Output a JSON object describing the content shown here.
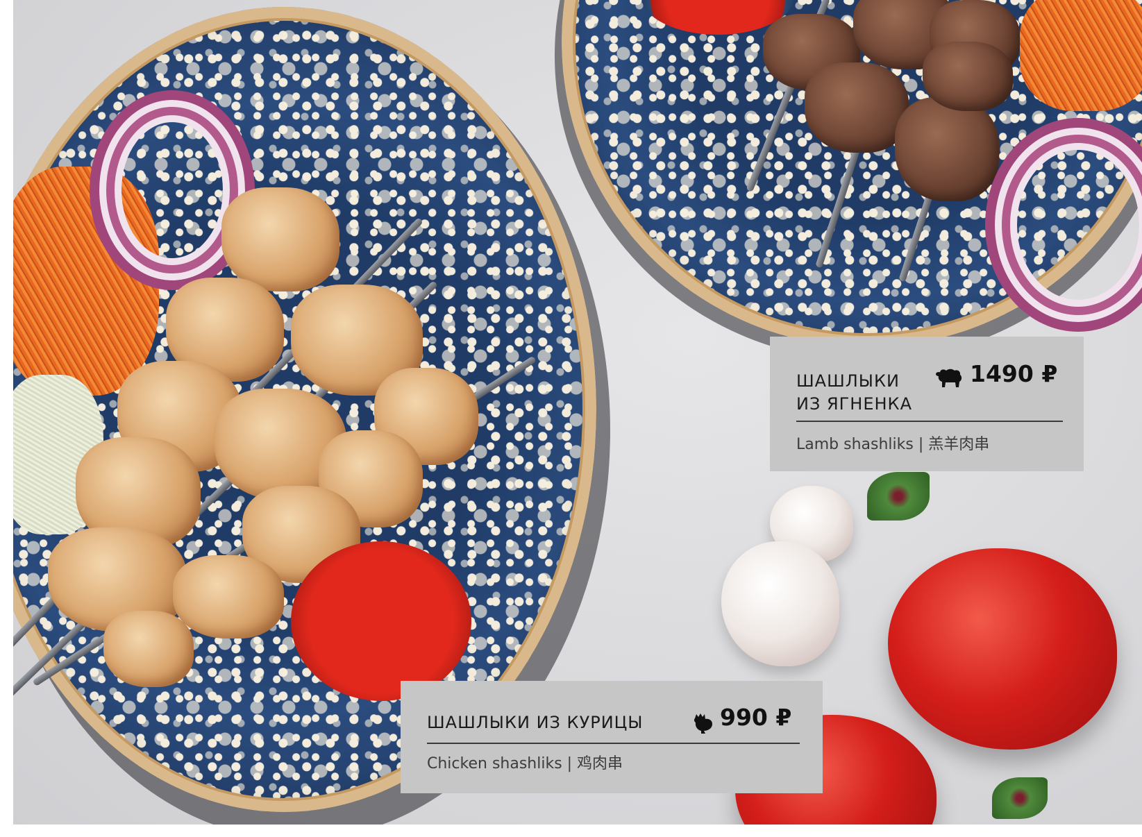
{
  "menu_items": [
    {
      "name_line1": "ШАШЛЫКИ",
      "name_line2": "ИЗ ЯГНЕНКА",
      "icon": "sheep-icon",
      "price": "1490 ₽",
      "subtitle": "Lamb shashliks | 羔羊肉串"
    },
    {
      "name": "ШАШЛЫКИ ИЗ КУРИЦЫ",
      "icon": "chicken-icon",
      "price": "990 ₽",
      "subtitle": "Chicken shashliks | 鸡肉串"
    }
  ],
  "colors": {
    "card_background": "#c6c6c6",
    "text_dark": "#111111",
    "plate_blue": "#1f3b66",
    "sauce_red": "#e2281c"
  }
}
